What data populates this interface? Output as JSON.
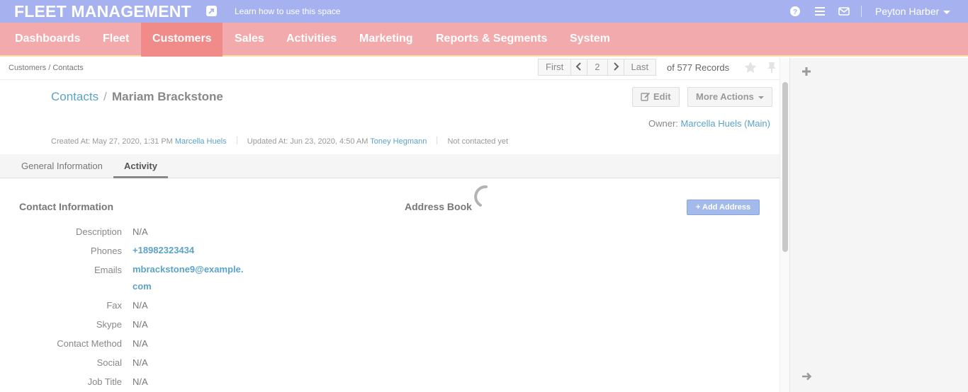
{
  "header": {
    "brand": "FLEET MANAGEMENT",
    "learn_link": "Learn how to use this space",
    "user_name": "Peyton Harber"
  },
  "nav": {
    "items": [
      {
        "label": "Dashboards"
      },
      {
        "label": "Fleet"
      },
      {
        "label": "Customers",
        "active": true
      },
      {
        "label": "Sales"
      },
      {
        "label": "Activities"
      },
      {
        "label": "Marketing"
      },
      {
        "label": "Reports & Segments"
      },
      {
        "label": "System"
      }
    ]
  },
  "breadcrumb": "Customers / Contacts",
  "pager": {
    "first": "First",
    "page": "2",
    "last": "Last",
    "records": "of 577 Records"
  },
  "title": {
    "section": "Contacts",
    "separator": "/",
    "name": "Mariam Brackstone"
  },
  "buttons": {
    "edit": "Edit",
    "more_actions": "More Actions"
  },
  "owner": {
    "label": "Owner:",
    "name": "Marcella Huels",
    "unit": "Main"
  },
  "meta": {
    "created_label": "Created At: May 27, 2020, 1:31 PM",
    "created_by": "Marcella Huels",
    "updated_label": "Updated At: Jun 23, 2020, 4:50 AM",
    "updated_by": "Toney Hegmann",
    "contacted": "Not contacted yet"
  },
  "tabs": [
    {
      "label": "General Information"
    },
    {
      "label": "Activity",
      "active": true
    }
  ],
  "contact_info": {
    "title": "Contact Information",
    "fields": [
      {
        "label": "Description",
        "value": "N/A"
      },
      {
        "label": "Phones",
        "value": "+18982323434"
      },
      {
        "label": "Emails",
        "value": "mbrackstone9@example.",
        "value2": "com"
      },
      {
        "label": "Fax",
        "value": "N/A"
      },
      {
        "label": "Skype",
        "value": "N/A"
      },
      {
        "label": "Contact Method",
        "value": "N/A"
      },
      {
        "label": "Social",
        "value": "N/A"
      },
      {
        "label": "Job Title",
        "value": "N/A"
      }
    ]
  },
  "address_book": {
    "title": "Address Book",
    "add_button": "+ Add Address"
  },
  "colors": {
    "topbar": "#a5b2ef",
    "nav": "#f2aaad",
    "nav_active": "#f08b8a",
    "link": "#5ba3c9"
  }
}
